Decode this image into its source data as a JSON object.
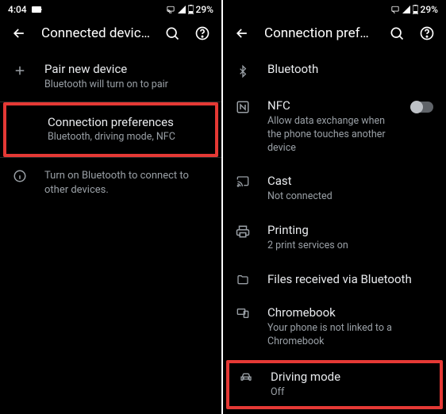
{
  "left": {
    "status": {
      "time": "4:04",
      "battery": "29%"
    },
    "appbar": {
      "title": "Connected devices"
    },
    "pair": {
      "label": "Pair new device",
      "sub": "Bluetooth will turn on to pair"
    },
    "connpref": {
      "label": "Connection preferences",
      "sub": "Bluetooth, driving mode, NFC"
    },
    "info": {
      "text": "Turn on Bluetooth to connect to other devices."
    }
  },
  "right": {
    "status": {
      "battery": "29%"
    },
    "appbar": {
      "title": "Connection preferen..."
    },
    "bluetooth": {
      "label": "Bluetooth"
    },
    "nfc": {
      "label": "NFC",
      "sub": "Allow data exchange when the phone touches another device"
    },
    "cast": {
      "label": "Cast",
      "sub": "Not connected"
    },
    "printing": {
      "label": "Printing",
      "sub": "2 print services on"
    },
    "files": {
      "label": "Files received via Bluetooth"
    },
    "chromebook": {
      "label": "Chromebook",
      "sub": "Your phone is not linked to a Chromebook"
    },
    "driving": {
      "label": "Driving mode",
      "sub": "Off"
    }
  }
}
